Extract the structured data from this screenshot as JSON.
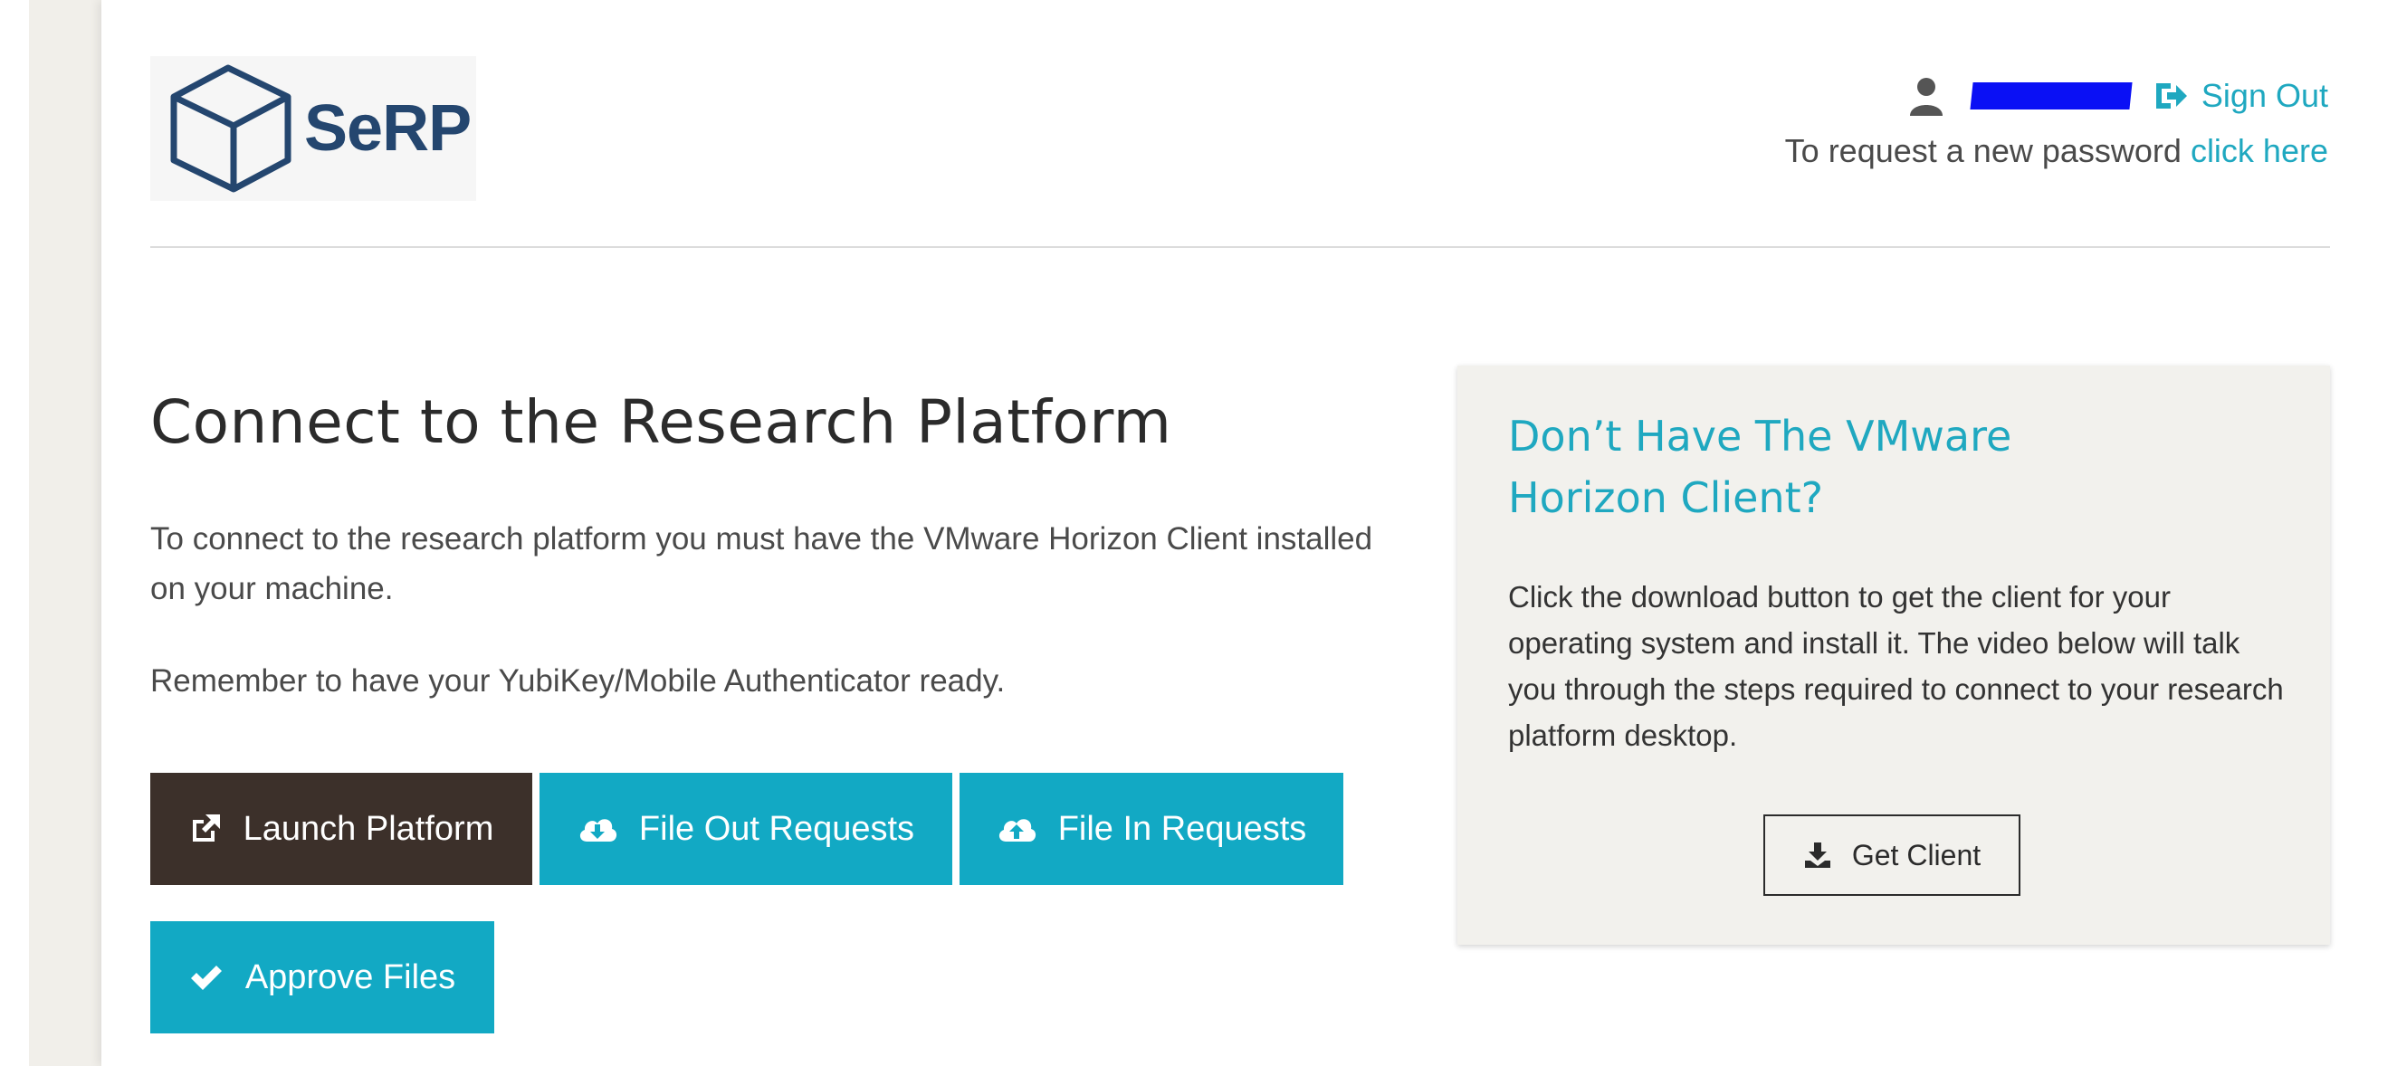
{
  "header": {
    "logo_text": "SeRP",
    "sign_out_label": "Sign Out",
    "password_prefix": "To request a new password",
    "password_link": "click here"
  },
  "main": {
    "title": "Connect to the Research Platform",
    "paragraph1": "To connect to the research platform you must have the VMware Horizon Client installed on your machine.",
    "paragraph2": "Remember to have your YubiKey/Mobile Authenticator ready.",
    "buttons": {
      "launch": "Launch Platform",
      "file_out": "File Out Requests",
      "file_in": "File In Requests",
      "approve": "Approve Files"
    }
  },
  "panel": {
    "title": "Don’t Have The VMware Horizon Client?",
    "text": "Click the download button to get the client for your operating system and install it. The video below will talk you through the steps required to connect to your research platform desktop.",
    "get_client_label": "Get Client"
  },
  "colors": {
    "accent": "#1fa8c0",
    "button_teal": "#12a9c4",
    "button_dark": "#3c302a",
    "logo": "#24466f",
    "redaction": "#0a10f5"
  },
  "icons": {
    "user": "user-icon",
    "sign_out": "sign-out-icon",
    "launch": "external-link-icon",
    "file_out": "cloud-download-icon",
    "file_in": "cloud-upload-icon",
    "approve": "checkmark-icon",
    "get_client": "download-icon",
    "logo": "cube-logo-icon"
  }
}
